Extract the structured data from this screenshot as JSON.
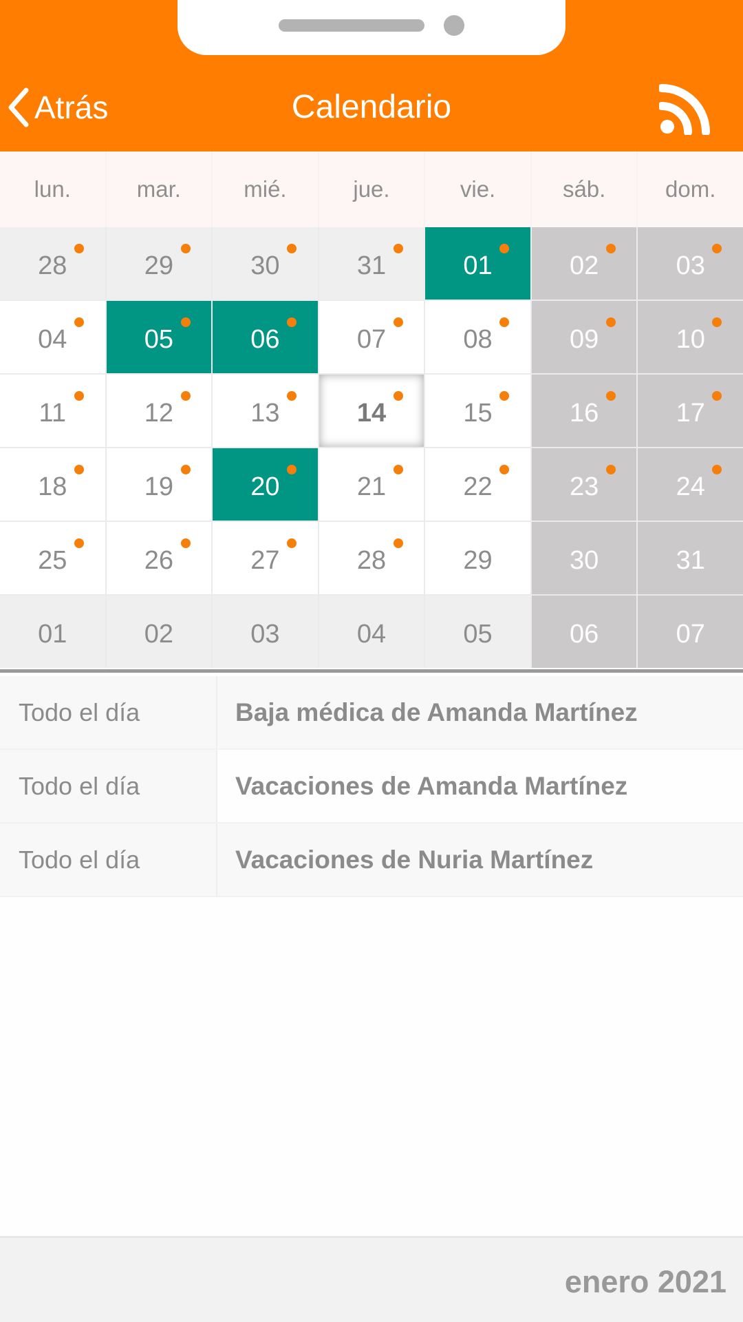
{
  "header": {
    "back_label": "Atrás",
    "title": "Calendario",
    "rss_icon": "rss-feed-icon",
    "background_color": "#ff7d00"
  },
  "weekdays": [
    "lun.",
    "mar.",
    "mié.",
    "jue.",
    "vie.",
    "sáb.",
    "dom."
  ],
  "colors": {
    "event_day": "#009683",
    "weekend": "#ccc9cb",
    "event_dot": "#f67f0b"
  },
  "calendar": {
    "weeks": [
      [
        {
          "day": "28",
          "state": "outside",
          "dot": true
        },
        {
          "day": "29",
          "state": "outside",
          "dot": true
        },
        {
          "day": "30",
          "state": "outside",
          "dot": true
        },
        {
          "day": "31",
          "state": "outside",
          "dot": true
        },
        {
          "day": "01",
          "state": "event",
          "dot": true
        },
        {
          "day": "02",
          "state": "weekend",
          "dot": true
        },
        {
          "day": "03",
          "state": "weekend",
          "dot": true
        }
      ],
      [
        {
          "day": "04",
          "state": "normal",
          "dot": true
        },
        {
          "day": "05",
          "state": "event",
          "dot": true
        },
        {
          "day": "06",
          "state": "event",
          "dot": true
        },
        {
          "day": "07",
          "state": "normal",
          "dot": true
        },
        {
          "day": "08",
          "state": "normal",
          "dot": true
        },
        {
          "day": "09",
          "state": "weekend",
          "dot": true
        },
        {
          "day": "10",
          "state": "weekend",
          "dot": true
        }
      ],
      [
        {
          "day": "11",
          "state": "normal",
          "dot": true
        },
        {
          "day": "12",
          "state": "normal",
          "dot": true
        },
        {
          "day": "13",
          "state": "normal",
          "dot": true
        },
        {
          "day": "14",
          "state": "today",
          "dot": true
        },
        {
          "day": "15",
          "state": "normal",
          "dot": true
        },
        {
          "day": "16",
          "state": "weekend",
          "dot": true
        },
        {
          "day": "17",
          "state": "weekend",
          "dot": true
        }
      ],
      [
        {
          "day": "18",
          "state": "normal",
          "dot": true
        },
        {
          "day": "19",
          "state": "normal",
          "dot": true
        },
        {
          "day": "20",
          "state": "event",
          "dot": true
        },
        {
          "day": "21",
          "state": "normal",
          "dot": true
        },
        {
          "day": "22",
          "state": "normal",
          "dot": true
        },
        {
          "day": "23",
          "state": "weekend",
          "dot": true
        },
        {
          "day": "24",
          "state": "weekend",
          "dot": true
        }
      ],
      [
        {
          "day": "25",
          "state": "normal",
          "dot": true
        },
        {
          "day": "26",
          "state": "normal",
          "dot": true
        },
        {
          "day": "27",
          "state": "normal",
          "dot": true
        },
        {
          "day": "28",
          "state": "normal",
          "dot": true
        },
        {
          "day": "29",
          "state": "normal",
          "dot": false
        },
        {
          "day": "30",
          "state": "weekend",
          "dot": false
        },
        {
          "day": "31",
          "state": "weekend",
          "dot": false
        }
      ],
      [
        {
          "day": "01",
          "state": "outside",
          "dot": false
        },
        {
          "day": "02",
          "state": "outside",
          "dot": false
        },
        {
          "day": "03",
          "state": "outside",
          "dot": false
        },
        {
          "day": "04",
          "state": "outside",
          "dot": false
        },
        {
          "day": "05",
          "state": "outside",
          "dot": false
        },
        {
          "day": "06",
          "state": "weekend",
          "dot": false
        },
        {
          "day": "07",
          "state": "weekend",
          "dot": false
        }
      ]
    ]
  },
  "events": [
    {
      "time": "Todo el día",
      "title": "Baja médica de Amanda Martínez"
    },
    {
      "time": "Todo el día",
      "title": "Vacaciones de Amanda Martínez"
    },
    {
      "time": "Todo el día",
      "title": "Vacaciones de Nuria Martínez"
    }
  ],
  "footer": {
    "month_label": "enero 2021"
  }
}
